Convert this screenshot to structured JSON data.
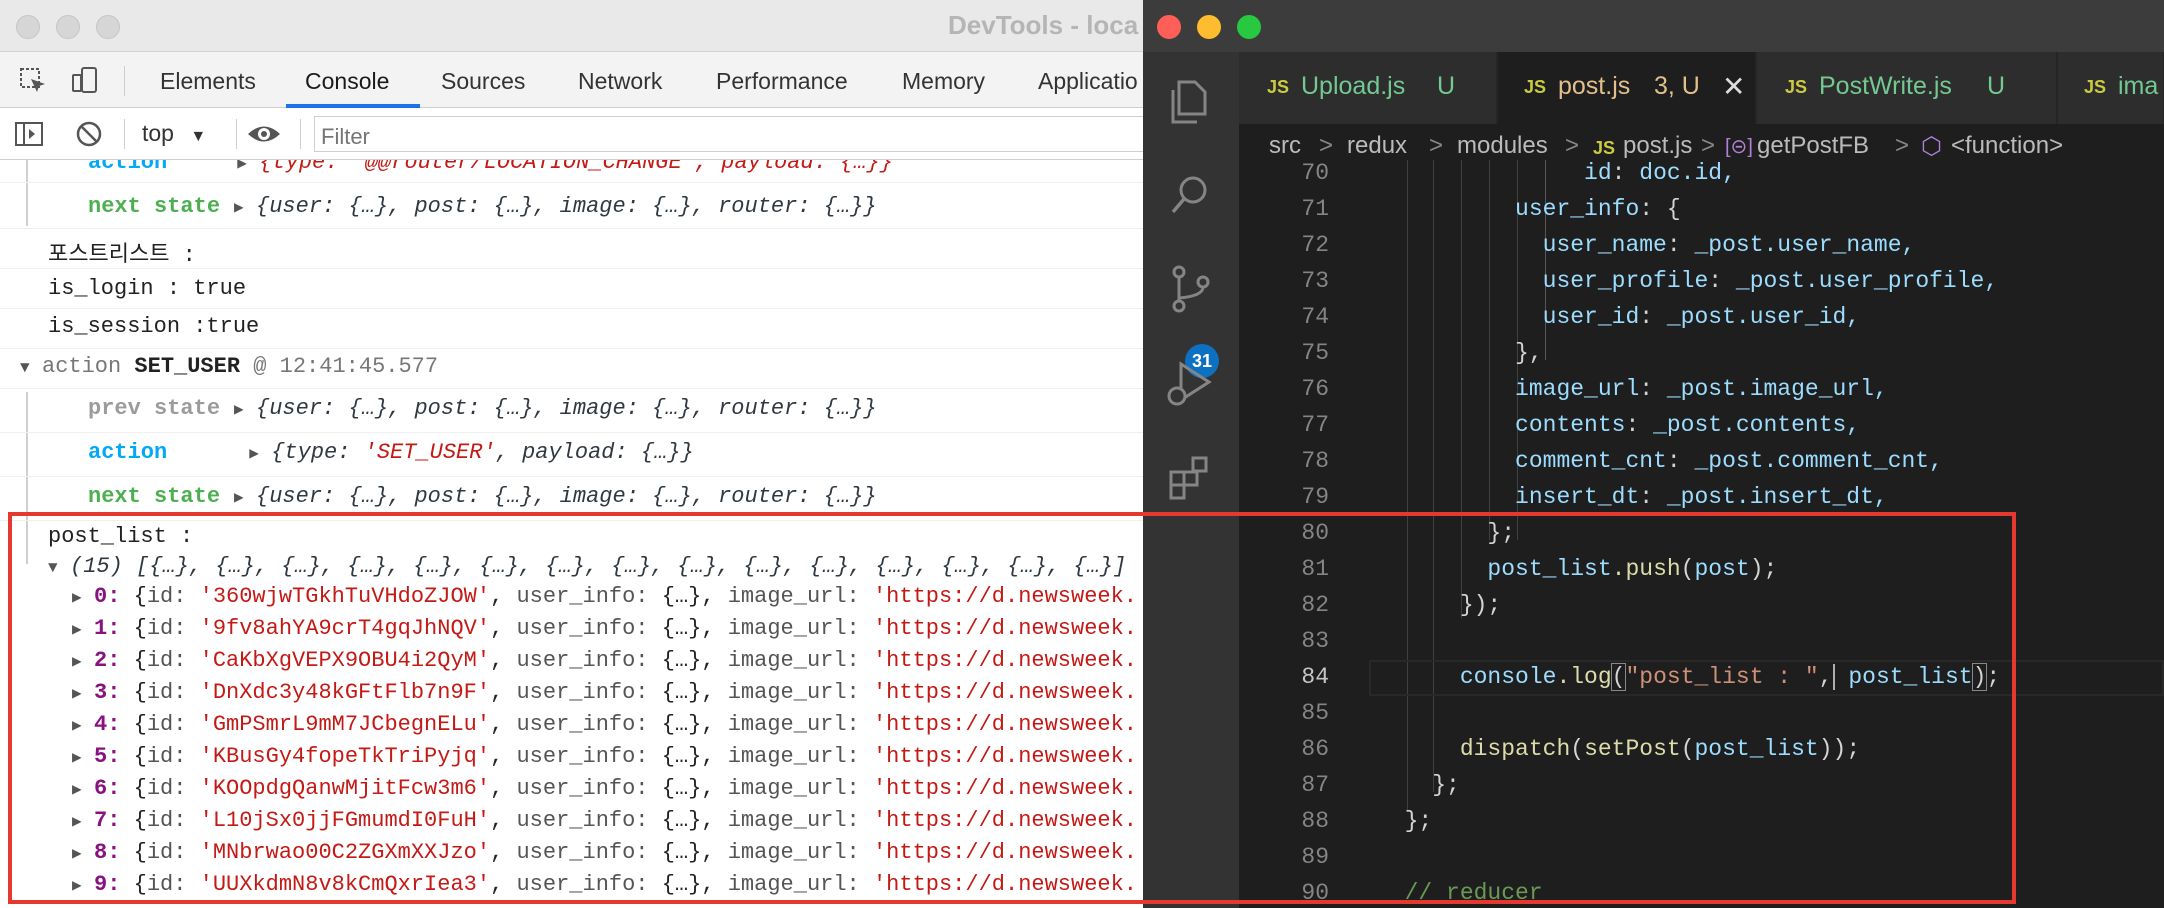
{
  "devtools": {
    "window_title": "DevTools - loca",
    "tabs": [
      "Elements",
      "Console",
      "Sources",
      "Network",
      "Performance",
      "Memory",
      "Applicatio"
    ],
    "active_tab": "Console",
    "context": "top",
    "filter_placeholder": "Filter",
    "console": {
      "partial_action_label": "action",
      "partial_action_value": "{type: '@@router/LOCATION_CHANGE', payload: {…}}",
      "next_state_label": "next state",
      "state_value": "{user: {…}, post: {…}, image: {…}, router: {…}}",
      "log_postlist_kr": "포스트리스트 :",
      "log_is_login": "is_login : true",
      "log_is_session": "is_session :true",
      "group_action_prefix": "action",
      "group_action_name": "SET_USER",
      "group_action_time": "@ 12:41:45.577",
      "prev_state_label": "prev state",
      "action_label": "action",
      "action_value_pre": "{type: ",
      "action_value_type": "'SET_USER'",
      "action_value_post": ", payload: {…}}",
      "post_list_label": "post_list :",
      "array_summary_count": "(15)",
      "array_summary": "[{…}, {…}, {…}, {…}, {…}, {…}, {…}, {…}, {…}, {…}, {…}, {…}, {…}, {…}, {…}]",
      "item_key_user_info": "user_info:",
      "item_val_user_info": "{…},",
      "item_key_image_url": "image_url:",
      "item_val_image_url": "'https://d.newsweek.",
      "items": [
        {
          "index": "0:",
          "id": "'360wjwTGkhTuVHdoZJOW'"
        },
        {
          "index": "1:",
          "id": "'9fv8ahYA9crT4gqJhNQV'"
        },
        {
          "index": "2:",
          "id": "'CaKbXgVEPX9OBU4i2QyM'"
        },
        {
          "index": "3:",
          "id": "'DnXdc3y48kGFtFlb7n9F'"
        },
        {
          "index": "4:",
          "id": "'GmPSmrL9mM7JCbegnELu'"
        },
        {
          "index": "5:",
          "id": "'KBusGy4fopeTkTriPyjq'"
        },
        {
          "index": "6:",
          "id": "'KOOpdgQanwMjitFcw3m6'"
        },
        {
          "index": "7:",
          "id": "'L10jSx0jjFGmumdI0FuH'"
        },
        {
          "index": "8:",
          "id": "'MNbrwao00C2ZGXmXXJzo'"
        },
        {
          "index": "9:",
          "id": "'UUXkdmN8v8kCmQxrIea3'"
        }
      ]
    }
  },
  "vscode": {
    "tabs": [
      {
        "badge": "JS",
        "name": "Upload.js",
        "status": "U",
        "color": "#73c991"
      },
      {
        "badge": "JS",
        "name": "post.js",
        "status": "3, U",
        "color": "#e2c08d"
      },
      {
        "badge": "JS",
        "name": "PostWrite.js",
        "status": "U",
        "color": "#73c991"
      },
      {
        "badge": "JS",
        "name": "ima",
        "status": "",
        "color": "#73c991"
      }
    ],
    "active_tab": "post.js",
    "scm_badge": "31",
    "breadcrumbs": {
      "seg1": "src",
      "seg2": "redux",
      "seg3": "modules",
      "seg4_badge": "JS",
      "seg4": "post.js",
      "seg5": "getPostFB",
      "seg6": "<function>",
      "sep": ">"
    },
    "line_numbers": [
      "70",
      "71",
      "72",
      "73",
      "74",
      "75",
      "76",
      "77",
      "78",
      "79",
      "80",
      "81",
      "82",
      "83",
      "84",
      "85",
      "86",
      "87",
      "88",
      "89",
      "90"
    ],
    "current_line": "84",
    "code": {
      "l70_key": "id",
      "l70_val": "doc.id,",
      "l71_key": "user_info",
      "l71_rest": ": {",
      "l72_key": "user_name",
      "l72_obj": "_post",
      "l72_prop": ".user_name,",
      "l73_key": "user_profile",
      "l73_obj": "_post",
      "l73_prop": ".user_profile,",
      "l74_key": "user_id",
      "l74_obj": "_post",
      "l74_prop": ".user_id,",
      "l75": "},",
      "l76_key": "image_url",
      "l76_obj": "_post",
      "l76_prop": ".image_url,",
      "l77_key": "contents",
      "l77_obj": "_post",
      "l77_prop": ".contents,",
      "l78_key": "comment_cnt",
      "l78_obj": "_post",
      "l78_prop": ".comment_cnt,",
      "l79_key": "insert_dt",
      "l79_obj": "_post",
      "l79_prop": ".insert_dt,",
      "l80": "};",
      "l81_var": "post_list",
      "l81_fn": ".push",
      "l81_arg": "post",
      "l81_end": ");",
      "l82": "});",
      "l84_obj": "console",
      "l84_fn": ".log",
      "l84_str": "\"post_list : \"",
      "l84_arg": "post_list",
      "l84_end": ");",
      "l86_fn": "dispatch",
      "l86_fn2": "setPost",
      "l86_arg": "post_list",
      "l86_end": "));",
      "l87": "};",
      "l88": "};",
      "l90": "// reducer"
    }
  },
  "colors": {
    "highlight_box": "#e7382f",
    "devtools_accent": "#1a73e8",
    "vscode_badge": "#0e70c0"
  }
}
